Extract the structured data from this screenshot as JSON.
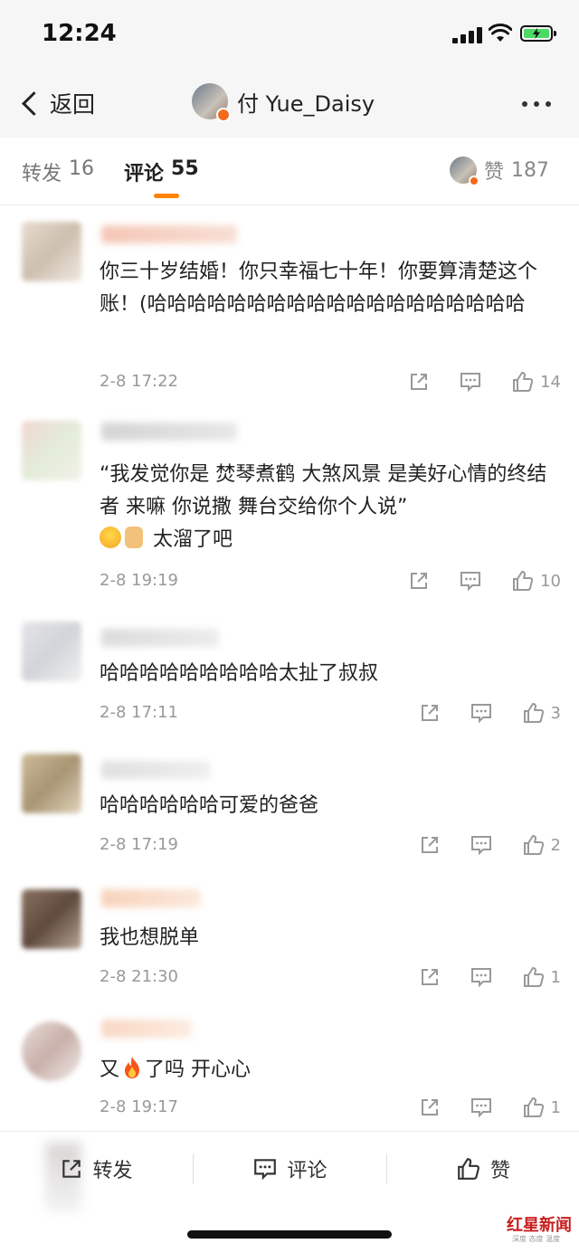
{
  "status_bar": {
    "time": "12:24"
  },
  "nav": {
    "back_label": "返回",
    "title": "付 Yue_Daisy"
  },
  "tabs": {
    "repost_label": "转发",
    "repost_count": "16",
    "comment_label": "评论",
    "comment_count": "55",
    "like_label": "赞",
    "like_count": "187"
  },
  "comments": [
    {
      "text": "你三十岁结婚！你只幸福七十年！你要算清楚这个账！(哈哈哈哈哈哈哈哈哈哈哈哈哈哈哈哈哈哈哈",
      "date": "2-8 17:22",
      "likes": "14"
    },
    {
      "text": "“我发觉你是 焚琴煮鹤 大煞风景 是美好心情的终结者 来嘛 你说撒 舞台交给你个人说”",
      "text2": "太溜了吧",
      "date": "2-8 19:19",
      "likes": "10"
    },
    {
      "text": "哈哈哈哈哈哈哈哈哈太扯了叔叔",
      "date": "2-8 17:11",
      "likes": "3"
    },
    {
      "text": "哈哈哈哈哈哈可爱的爸爸",
      "date": "2-8 17:19",
      "likes": "2"
    },
    {
      "text": "我也想脱单",
      "date": "2-8 21:30",
      "likes": "1"
    },
    {
      "text_before": "又",
      "text_after": "了吗 开心心",
      "date": "2-8 19:17",
      "likes": "1"
    }
  ],
  "bottom_bar": {
    "repost_label": "转发",
    "comment_label": "评论",
    "like_label": "赞"
  },
  "watermark": {
    "text": "红星新闻",
    "sub": "深度 态度 温度"
  },
  "colors": {
    "accent": "#ff8200",
    "text": "#222222",
    "meta": "#999999",
    "verified": "#f26b1d"
  },
  "icons": [
    "back-chevron-icon",
    "more-icon",
    "share-icon",
    "comment-icon",
    "like-icon",
    "fire-emoji",
    "laughing-emoji",
    "thumbs-up-emoji"
  ]
}
